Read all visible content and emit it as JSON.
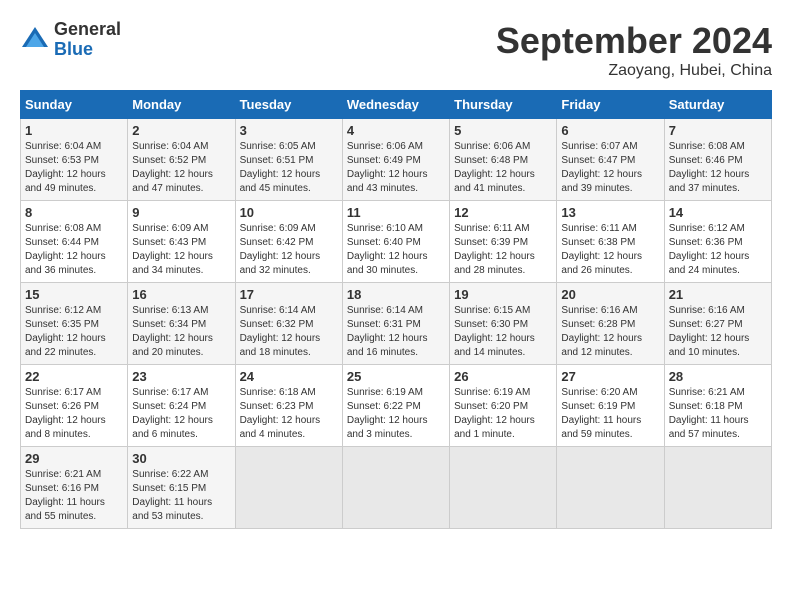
{
  "header": {
    "logo_general": "General",
    "logo_blue": "Blue",
    "month_title": "September 2024",
    "location": "Zaoyang, Hubei, China"
  },
  "days_of_week": [
    "Sunday",
    "Monday",
    "Tuesday",
    "Wednesday",
    "Thursday",
    "Friday",
    "Saturday"
  ],
  "weeks": [
    [
      {
        "day": 1,
        "sunrise": "6:04 AM",
        "sunset": "6:53 PM",
        "daylight": "12 hours and 49 minutes."
      },
      {
        "day": 2,
        "sunrise": "6:04 AM",
        "sunset": "6:52 PM",
        "daylight": "12 hours and 47 minutes."
      },
      {
        "day": 3,
        "sunrise": "6:05 AM",
        "sunset": "6:51 PM",
        "daylight": "12 hours and 45 minutes."
      },
      {
        "day": 4,
        "sunrise": "6:06 AM",
        "sunset": "6:49 PM",
        "daylight": "12 hours and 43 minutes."
      },
      {
        "day": 5,
        "sunrise": "6:06 AM",
        "sunset": "6:48 PM",
        "daylight": "12 hours and 41 minutes."
      },
      {
        "day": 6,
        "sunrise": "6:07 AM",
        "sunset": "6:47 PM",
        "daylight": "12 hours and 39 minutes."
      },
      {
        "day": 7,
        "sunrise": "6:08 AM",
        "sunset": "6:46 PM",
        "daylight": "12 hours and 37 minutes."
      }
    ],
    [
      {
        "day": 8,
        "sunrise": "6:08 AM",
        "sunset": "6:44 PM",
        "daylight": "12 hours and 36 minutes."
      },
      {
        "day": 9,
        "sunrise": "6:09 AM",
        "sunset": "6:43 PM",
        "daylight": "12 hours and 34 minutes."
      },
      {
        "day": 10,
        "sunrise": "6:09 AM",
        "sunset": "6:42 PM",
        "daylight": "12 hours and 32 minutes."
      },
      {
        "day": 11,
        "sunrise": "6:10 AM",
        "sunset": "6:40 PM",
        "daylight": "12 hours and 30 minutes."
      },
      {
        "day": 12,
        "sunrise": "6:11 AM",
        "sunset": "6:39 PM",
        "daylight": "12 hours and 28 minutes."
      },
      {
        "day": 13,
        "sunrise": "6:11 AM",
        "sunset": "6:38 PM",
        "daylight": "12 hours and 26 minutes."
      },
      {
        "day": 14,
        "sunrise": "6:12 AM",
        "sunset": "6:36 PM",
        "daylight": "12 hours and 24 minutes."
      }
    ],
    [
      {
        "day": 15,
        "sunrise": "6:12 AM",
        "sunset": "6:35 PM",
        "daylight": "12 hours and 22 minutes."
      },
      {
        "day": 16,
        "sunrise": "6:13 AM",
        "sunset": "6:34 PM",
        "daylight": "12 hours and 20 minutes."
      },
      {
        "day": 17,
        "sunrise": "6:14 AM",
        "sunset": "6:32 PM",
        "daylight": "12 hours and 18 minutes."
      },
      {
        "day": 18,
        "sunrise": "6:14 AM",
        "sunset": "6:31 PM",
        "daylight": "12 hours and 16 minutes."
      },
      {
        "day": 19,
        "sunrise": "6:15 AM",
        "sunset": "6:30 PM",
        "daylight": "12 hours and 14 minutes."
      },
      {
        "day": 20,
        "sunrise": "6:16 AM",
        "sunset": "6:28 PM",
        "daylight": "12 hours and 12 minutes."
      },
      {
        "day": 21,
        "sunrise": "6:16 AM",
        "sunset": "6:27 PM",
        "daylight": "12 hours and 10 minutes."
      }
    ],
    [
      {
        "day": 22,
        "sunrise": "6:17 AM",
        "sunset": "6:26 PM",
        "daylight": "12 hours and 8 minutes."
      },
      {
        "day": 23,
        "sunrise": "6:17 AM",
        "sunset": "6:24 PM",
        "daylight": "12 hours and 6 minutes."
      },
      {
        "day": 24,
        "sunrise": "6:18 AM",
        "sunset": "6:23 PM",
        "daylight": "12 hours and 4 minutes."
      },
      {
        "day": 25,
        "sunrise": "6:19 AM",
        "sunset": "6:22 PM",
        "daylight": "12 hours and 3 minutes."
      },
      {
        "day": 26,
        "sunrise": "6:19 AM",
        "sunset": "6:20 PM",
        "daylight": "12 hours and 1 minute."
      },
      {
        "day": 27,
        "sunrise": "6:20 AM",
        "sunset": "6:19 PM",
        "daylight": "11 hours and 59 minutes."
      },
      {
        "day": 28,
        "sunrise": "6:21 AM",
        "sunset": "6:18 PM",
        "daylight": "11 hours and 57 minutes."
      }
    ],
    [
      {
        "day": 29,
        "sunrise": "6:21 AM",
        "sunset": "6:16 PM",
        "daylight": "11 hours and 55 minutes."
      },
      {
        "day": 30,
        "sunrise": "6:22 AM",
        "sunset": "6:15 PM",
        "daylight": "11 hours and 53 minutes."
      },
      null,
      null,
      null,
      null,
      null
    ]
  ]
}
